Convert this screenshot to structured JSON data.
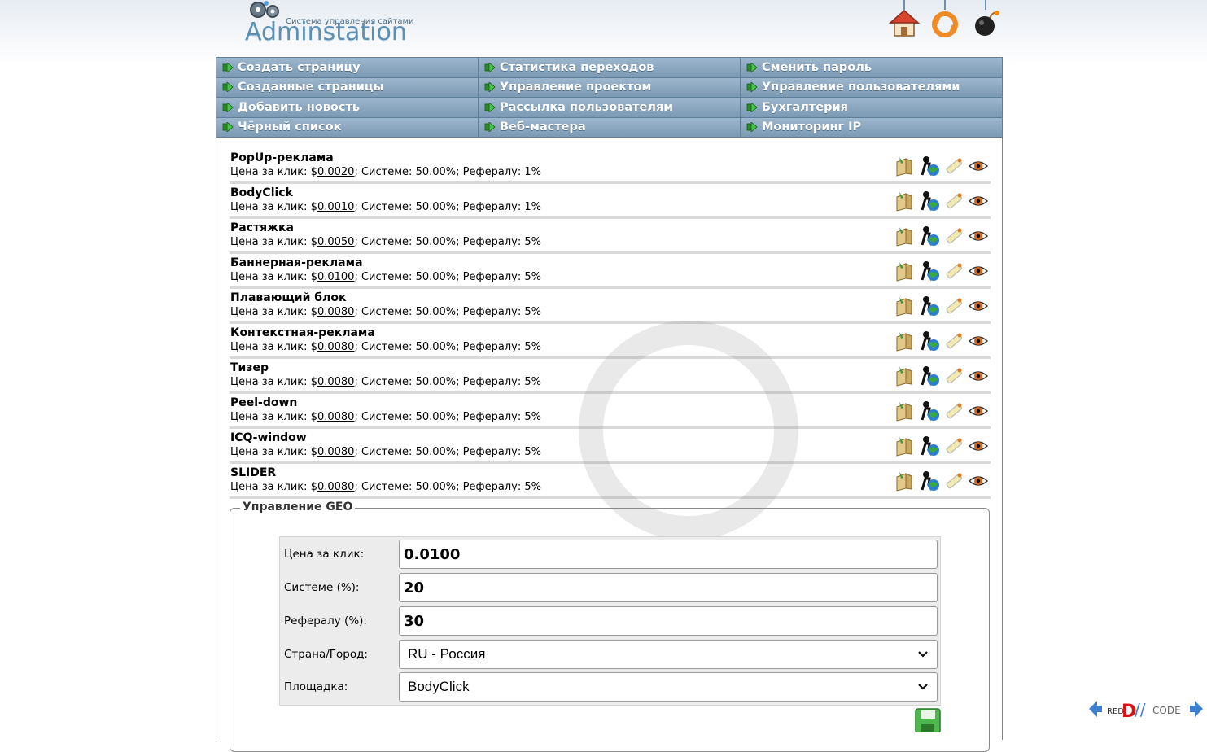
{
  "header": {
    "logo_subtitle": "Система управления сайтами",
    "logo_title": "Adminstation",
    "icons": [
      "home-icon",
      "refresh-icon",
      "bomb-icon"
    ]
  },
  "menu": [
    "Создать страницу",
    "Статистика переходов",
    "Сменить пароль",
    "Созданные страницы",
    "Управление проектом",
    "Управление пользователями",
    "Добавить новость",
    "Рассылка пользователям",
    "Бухгалтерия",
    "Чёрный список",
    "Веб-мастера",
    "Мониторинг IP"
  ],
  "labels": {
    "price": "Цена за клик:",
    "system": "Системе:",
    "referral": "Рефералу:"
  },
  "ad_types": [
    {
      "name": "PopUp-реклама",
      "currency": "$",
      "price": "0.0020",
      "system": "50.00%",
      "referral": "1%"
    },
    {
      "name": "BodyClick",
      "currency": "$",
      "price": "0.0010",
      "system": "50.00%",
      "referral": "1%"
    },
    {
      "name": "Растяжка",
      "currency": "$",
      "price": "0.0050",
      "system": "50.00%",
      "referral": "5%"
    },
    {
      "name": "Баннерная-реклама",
      "currency": "$",
      "price": "0.0100",
      "system": "50.00%",
      "referral": "5%"
    },
    {
      "name": "Плавающий блок",
      "currency": "$",
      "price": "0.0080",
      "system": "50.00%",
      "referral": "5%"
    },
    {
      "name": "Контекстная-реклама",
      "currency": "$",
      "price": "0.0080",
      "system": "50.00%",
      "referral": "5%"
    },
    {
      "name": "Тизер",
      "currency": "$",
      "price": "0.0080",
      "system": "50.00%",
      "referral": "5%"
    },
    {
      "name": "Peel-down",
      "currency": "$",
      "price": "0.0080",
      "system": "50.00%",
      "referral": "5%"
    },
    {
      "name": "ICQ-window",
      "currency": "$",
      "price": "0.0080",
      "system": "50.00%",
      "referral": "5%"
    },
    {
      "name": "SLIDER",
      "currency": "$",
      "price": "0.0080",
      "system": "50.00%",
      "referral": "5%"
    }
  ],
  "row_actions": [
    "box-edit-icon",
    "user-globe-icon",
    "pencil-icon",
    "eye-icon"
  ],
  "geo": {
    "legend": "Управление GEO",
    "fields": {
      "price_label": "Цена за клик:",
      "price_value": "0.0100",
      "system_label": "Системе (%):",
      "system_value": "20",
      "referral_label": "Рефералу (%):",
      "referral_value": "30",
      "country_label": "Страна/Город:",
      "country_value": "RU - Россия",
      "platform_label": "Площадка:",
      "platform_value": "BodyClick"
    }
  },
  "colors": {
    "menu_bg": "#8aa7bf",
    "menu_border": "#5f7f98",
    "row_divider": "#d9d9d9",
    "form_bg": "#ececec"
  }
}
